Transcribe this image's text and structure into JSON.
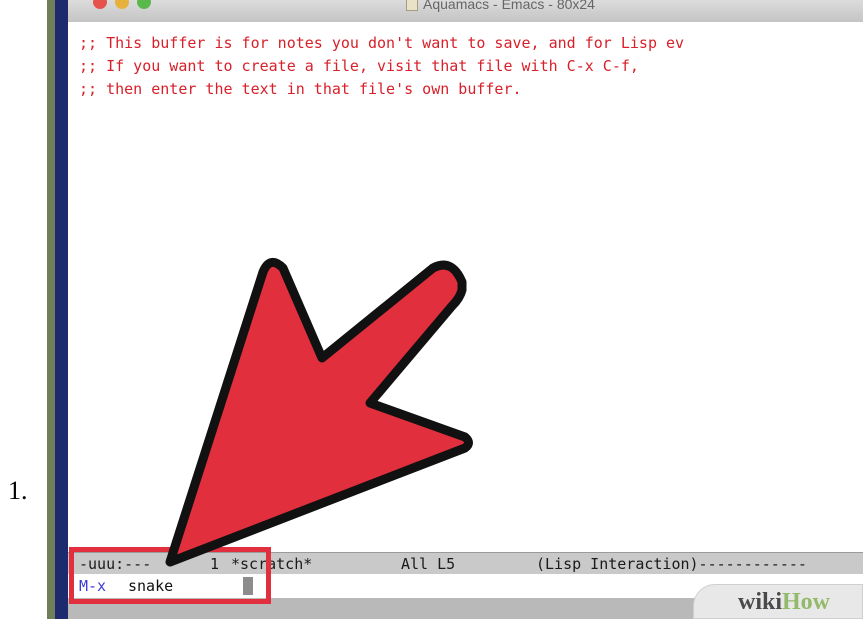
{
  "list_marker": "1.",
  "window": {
    "title": "Aquamacs - Emacs - 80x24",
    "buttons": {
      "close": "close-button",
      "minimize": "minimize-button",
      "zoom": "zoom-button"
    }
  },
  "buffer": {
    "lines": [
      ";; This buffer is for notes you don't want to save, and for Lisp ev",
      ";; If you want to create a file, visit that file with C-x C-f,",
      ";; then enter the text in that file's own buffer."
    ],
    "text_color": "#d8202a"
  },
  "modeline": {
    "status": "-uuu:---",
    "line_indicator": "1",
    "buffer_name": "*scratch*",
    "position": "All L5",
    "mode": "(Lisp Interaction)------------"
  },
  "minibuffer": {
    "prompt": "M-x",
    "input": "snake"
  },
  "watermark": {
    "wiki": "wiki",
    "how": "How"
  },
  "annotation": {
    "arrow_color": "#e12f3e",
    "outline_color": "#111111"
  }
}
